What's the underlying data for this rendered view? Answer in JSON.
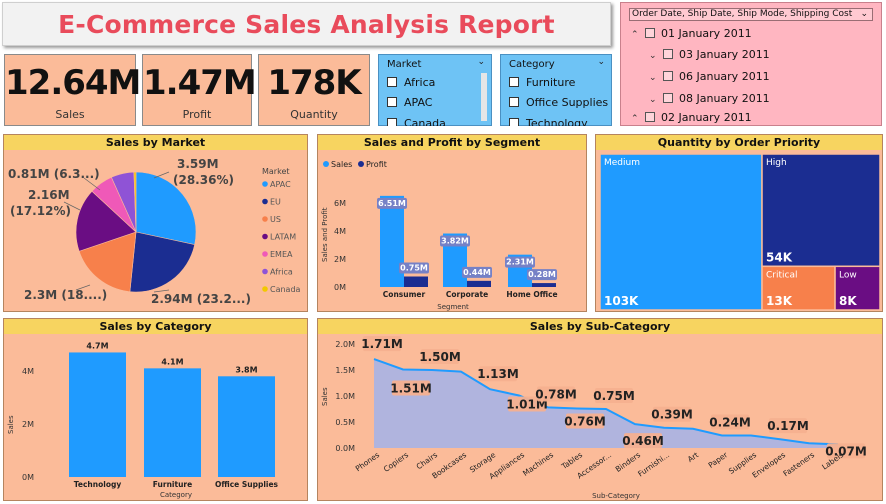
{
  "report": {
    "title": "E-Commerce Sales Analysis Report"
  },
  "kpis": [
    {
      "value": "12.64M",
      "label": "Sales"
    },
    {
      "value": "1.47M",
      "label": "Profit"
    },
    {
      "value": "178K",
      "label": "Quantity"
    }
  ],
  "market_slicer": {
    "header": "Market",
    "options": [
      "Africa",
      "APAC",
      "Canada"
    ]
  },
  "category_slicer": {
    "header": "Category",
    "options": [
      "Furniture",
      "Office Supplies",
      "Technology"
    ]
  },
  "date_slicer": {
    "header": "Order Date, Ship Date, Ship Mode, Shipping Cost",
    "rows": [
      "01 January 2011",
      "03 January 2011",
      "06 January 2011",
      "08 January 2011",
      "02 January 2011"
    ]
  },
  "panels": {
    "market": "Sales by Market",
    "segment": "Sales and Profit by Segment",
    "priority": "Quantity by Order Priority",
    "category": "Sales by Category",
    "subcategory": "Sales by Sub-Category"
  },
  "colors": {
    "blue": "#1f9bff",
    "navy": "#1b2d91",
    "orange": "#f7804b",
    "purple": "#6a0d83",
    "pink": "#ef59b8",
    "violet": "#8f53d6",
    "yellow": "#f2c800"
  },
  "chart_data": [
    {
      "type": "pie",
      "title": "Sales by Market",
      "legend_title": "Market",
      "legend": [
        "APAC",
        "EU",
        "US",
        "LATAM",
        "EMEA",
        "Africa",
        "Canada"
      ],
      "values": [
        3.59,
        2.94,
        2.3,
        2.16,
        0.81,
        0.78,
        0.07
      ],
      "data_labels": [
        "3.59M",
        "(28.36%)",
        "2.94M (23.2...)",
        "2.3M (18....)",
        "2.16M",
        "(17.12%)",
        "0.81M (6.3...)"
      ]
    },
    {
      "type": "bar",
      "title": "Sales and Profit by Segment",
      "categories": [
        "Consumer",
        "Corporate",
        "Home Office"
      ],
      "series": [
        {
          "name": "Sales",
          "values": [
            6.51,
            3.82,
            2.31
          ],
          "labels": [
            "6.51M",
            "3.82M",
            "2.31M"
          ]
        },
        {
          "name": "Profit",
          "values": [
            0.75,
            0.44,
            0.28
          ],
          "labels": [
            "0.75M",
            "0.44M",
            "0.28M"
          ]
        }
      ],
      "xlabel": "Segment",
      "ylabel": "Sales and Profit",
      "yticks": [
        "0M",
        "2M",
        "4M",
        "6M"
      ],
      "ylim": [
        0,
        7
      ]
    },
    {
      "type": "treemap",
      "title": "Quantity by Order Priority",
      "categories": [
        "Medium",
        "High",
        "Critical",
        "Low"
      ],
      "values": [
        103,
        54,
        13,
        8
      ],
      "labels": [
        "103K",
        "54K",
        "13K",
        "8K"
      ]
    },
    {
      "type": "bar",
      "title": "Sales by Category",
      "categories": [
        "Technology",
        "Furniture",
        "Office Supplies"
      ],
      "values": [
        4.7,
        4.1,
        3.8
      ],
      "labels": [
        "4.7M",
        "4.1M",
        "3.8M"
      ],
      "xlabel": "Category",
      "ylabel": "Sales",
      "yticks": [
        "0M",
        "2M",
        "4M"
      ],
      "ylim": [
        0,
        5
      ]
    },
    {
      "type": "area",
      "title": "Sales by Sub-Category",
      "categories": [
        "Phones",
        "Copiers",
        "Chairs",
        "Bookcases",
        "Storage",
        "Appliances",
        "Machines",
        "Tables",
        "Accessor...",
        "Binders",
        "Furnishi...",
        "Art",
        "Paper",
        "Supplies",
        "Envelopes",
        "Fasteners",
        "Labels"
      ],
      "values": [
        1.71,
        1.51,
        1.5,
        1.47,
        1.13,
        1.01,
        0.78,
        0.76,
        0.75,
        0.46,
        0.39,
        0.37,
        0.24,
        0.24,
        0.17,
        0.09,
        0.07
      ],
      "labels": [
        "1.71M",
        "1.51M",
        "1.50M",
        "",
        "1.13M",
        "1.01M",
        "0.78M",
        "0.76M",
        "0.75M",
        "0.46M",
        "0.39M",
        "",
        "0.24M",
        "",
        "0.17M",
        "",
        "0.07M"
      ],
      "xlabel": "Sub-Category",
      "ylabel": "Sales",
      "yticks": [
        "0.0M",
        "0.5M",
        "1.0M",
        "1.5M",
        "2.0M"
      ],
      "ylim": [
        0,
        2
      ]
    }
  ]
}
